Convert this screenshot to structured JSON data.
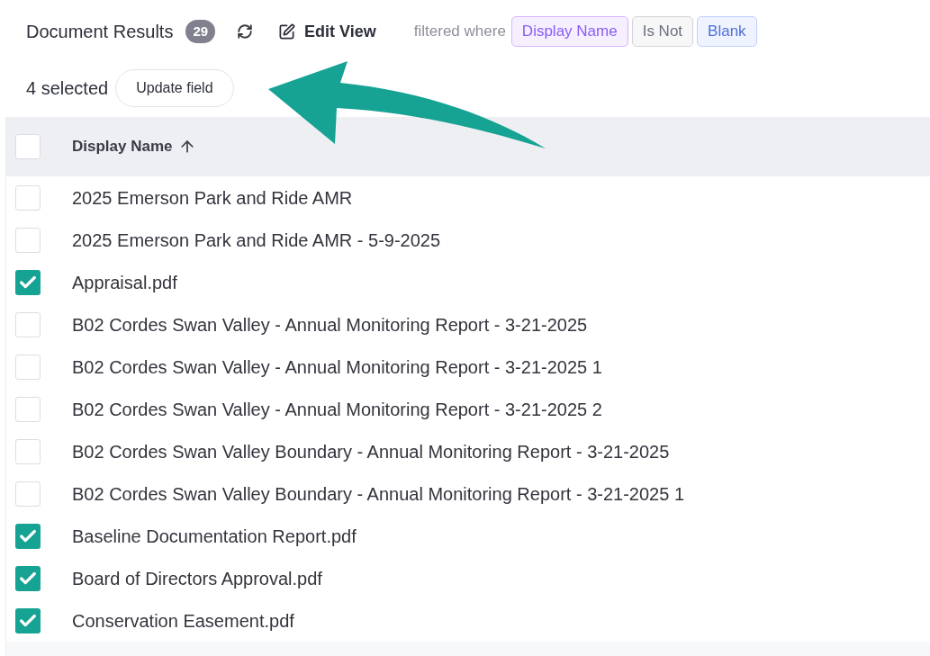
{
  "header": {
    "title": "Document Results",
    "count": "29",
    "edit_view": "Edit View",
    "filter_prefix": "filtered where",
    "filter_chips": [
      {
        "label": "Display Name",
        "kind": "field"
      },
      {
        "label": "Is Not",
        "kind": "operator"
      },
      {
        "label": "Blank",
        "kind": "value"
      }
    ]
  },
  "selection": {
    "count_label": "4 selected",
    "action": "Update field"
  },
  "table": {
    "columns": [
      {
        "label": "Display Name",
        "sort_ascending": true
      }
    ],
    "select_all": {
      "checked": false
    },
    "rows": [
      {
        "name": "2025 Emerson Park and Ride AMR",
        "checked": false
      },
      {
        "name": "2025 Emerson Park and Ride AMR - 5-9-2025",
        "checked": false
      },
      {
        "name": "Appraisal.pdf",
        "checked": true
      },
      {
        "name": "B02 Cordes Swan Valley - Annual Monitoring Report - 3-21-2025",
        "checked": false
      },
      {
        "name": "B02 Cordes Swan Valley - Annual Monitoring Report - 3-21-2025 1",
        "checked": false
      },
      {
        "name": "B02 Cordes Swan Valley - Annual Monitoring Report - 3-21-2025 2",
        "checked": false
      },
      {
        "name": "B02 Cordes Swan Valley Boundary - Annual Monitoring Report - 3-21-2025",
        "checked": false
      },
      {
        "name": "B02 Cordes Swan Valley Boundary - Annual Monitoring Report - 3-21-2025 1",
        "checked": false
      },
      {
        "name": "Baseline Documentation Report.pdf",
        "checked": true
      },
      {
        "name": "Board of Directors Approval.pdf",
        "checked": true
      },
      {
        "name": "Conservation Easement.pdf",
        "checked": true
      }
    ]
  }
}
